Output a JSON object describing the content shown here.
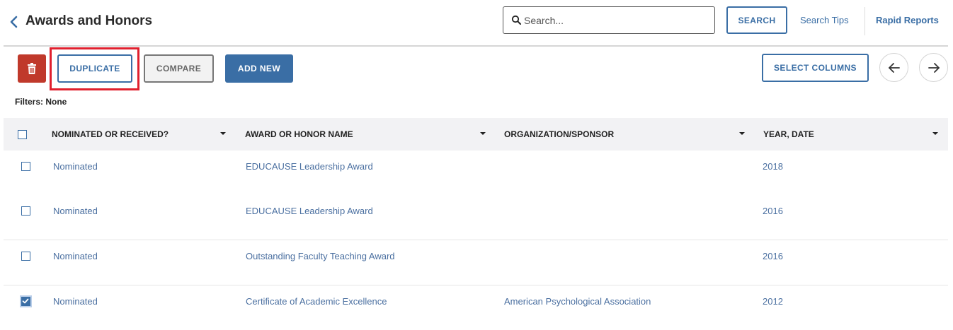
{
  "header": {
    "title": "Awards and Honors",
    "search_placeholder": "Search...",
    "search_button": "SEARCH",
    "search_tips": "Search Tips",
    "rapid_reports": "Rapid Reports"
  },
  "toolbar": {
    "duplicate": "DUPLICATE",
    "compare": "COMPARE",
    "add_new": "ADD NEW",
    "select_columns": "SELECT COLUMNS"
  },
  "filters": "Filters: None",
  "table": {
    "columns": [
      "NOMINATED OR RECEIVED?",
      "AWARD OR HONOR NAME",
      "ORGANIZATION/SPONSOR",
      "YEAR, DATE"
    ],
    "rows": [
      {
        "status": "Nominated",
        "name": "EDUCAUSE Leadership Award",
        "org": "",
        "year": "2018",
        "checked": false
      },
      {
        "status": "Nominated",
        "name": "EDUCAUSE Leadership Award",
        "org": "",
        "year": "2016",
        "checked": false
      },
      {
        "status": "Nominated",
        "name": "Outstanding Faculty Teaching Award",
        "org": "",
        "year": "2016",
        "checked": false
      },
      {
        "status": "Nominated",
        "name": "Certificate of Academic Excellence",
        "org": "American Psychological Association",
        "year": "2012",
        "checked": true
      }
    ]
  },
  "colors": {
    "accent": "#3a6ea5",
    "delete": "#c0392b",
    "highlight": "#e0202e"
  }
}
